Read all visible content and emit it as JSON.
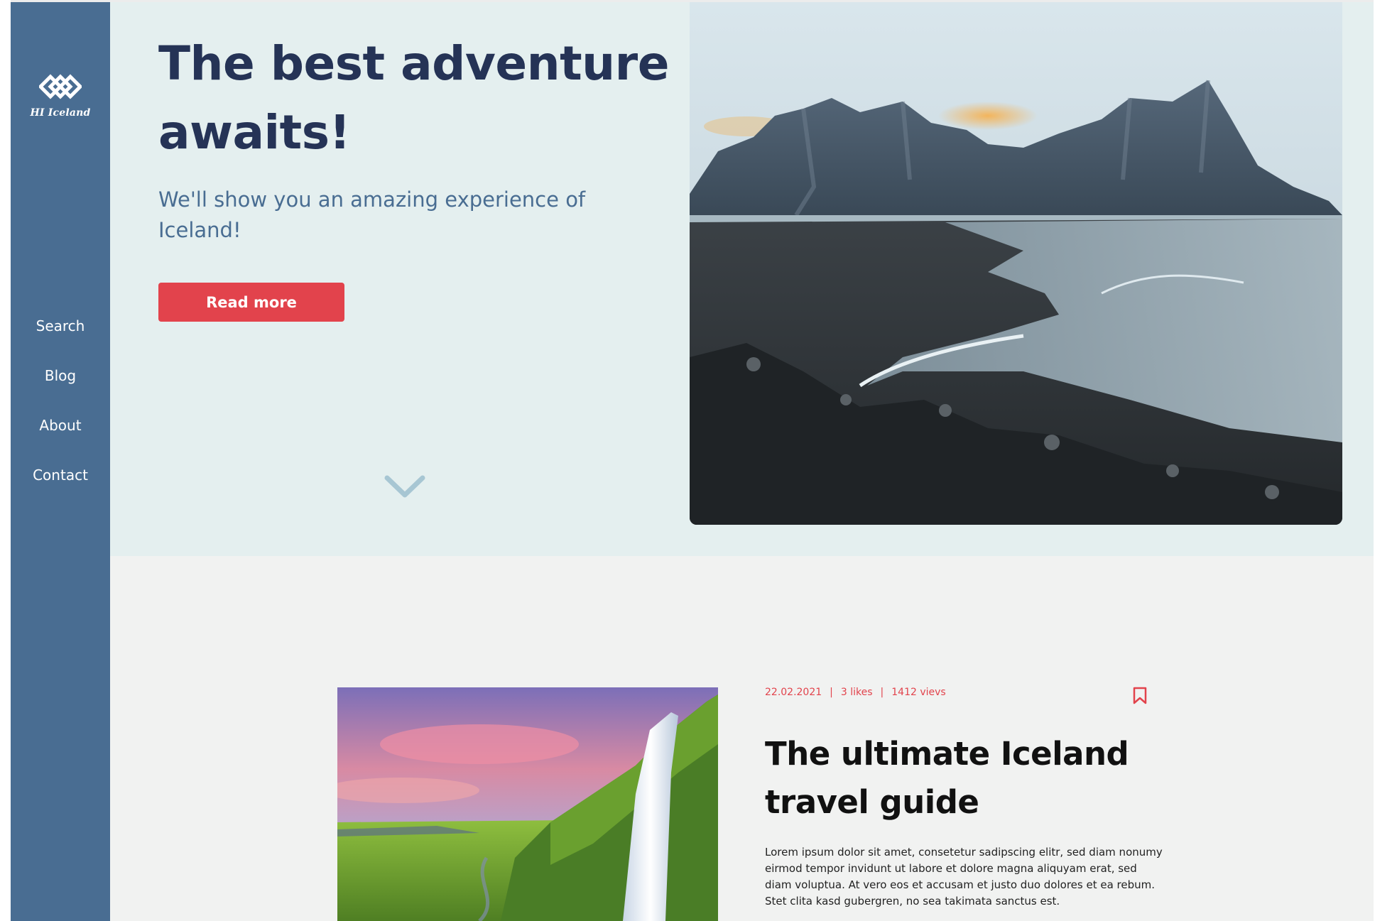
{
  "brand": {
    "name": "HI Iceland"
  },
  "nav": {
    "items": [
      {
        "label": "Search"
      },
      {
        "label": "Blog"
      },
      {
        "label": "About"
      },
      {
        "label": "Contact"
      }
    ]
  },
  "hero": {
    "title": "The best adventure awaits!",
    "subtitle": "We'll show you an amazing experience of Iceland!",
    "cta_label": "Read more"
  },
  "post": {
    "date": "22.02.2021",
    "likes": "3 likes",
    "views": "1412 vievs",
    "title": "The ultimate Iceland travel guide",
    "excerpt": "Lorem ipsum dolor sit amet, consetetur sadipscing elitr, sed diam nonumy eirmod tempor invidunt ut labore et dolore magna aliquyam erat, sed diam voluptua. At vero eos et accusam et justo duo dolores et ea rebum. Stet clita kasd gubergren, no sea takimata sanctus est."
  },
  "colors": {
    "sidebar": "#496d92",
    "hero_background": "#e4efef",
    "title_navy": "#253356",
    "accent_red": "#e2434c",
    "chevron": "#a7c6d3"
  },
  "icons": {
    "logo": "diamond-logo-icon",
    "scroll": "chevron-down-icon",
    "bookmark": "bookmark-icon"
  }
}
